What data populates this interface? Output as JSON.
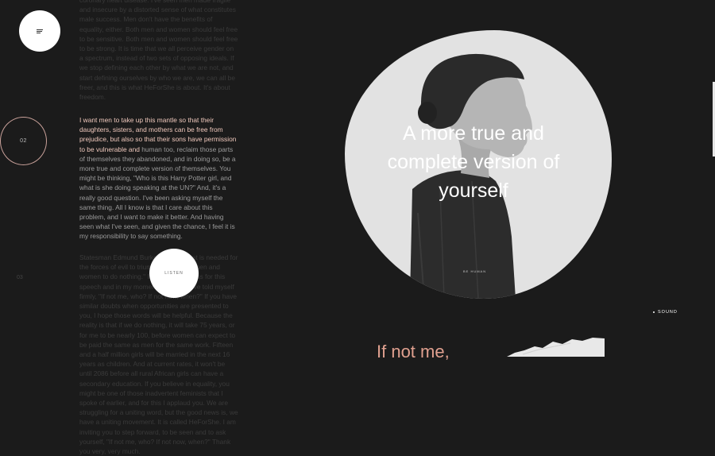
{
  "nav": {
    "menu_icon": "menu-icon"
  },
  "sections": [
    {
      "number": "02"
    },
    {
      "number": "03"
    }
  ],
  "article": {
    "para_top": "coronary heart disease. I've seen men made fragile and insecure by a distorted sense of what constitutes male success. Men don't have the benefits of equality, either. Both men and women should feel free to be sensitive. Both men and women should feel free to be strong. It is time that we all perceive gender on a spectrum, instead of two sets of opposing ideals. If we stop defining each other by what we are not, and start defining ourselves by who we are, we can all be freer, and this is what HeForShe is about. It's about freedom.",
    "para_mid_highlight": "I want men to take up this mantle so that their daughters, sisters, and mothers can be free from prejudice, but also so that their sons have permission to be vulnerable and",
    "para_mid_rest": " human too, reclaim those parts of themselves they abandoned, and in doing so, be a more true and complete version of themselves. You might be thinking, \"Who is this Harry Potter girl, and what is she doing speaking at the UN?\" And, it's a really good question. I've been asking myself the same thing. All I know is that I care about this problem, and I want to make it better. And having seen what I've seen, and given the chance, I feel it is my responsibility to say something.",
    "para_bot": "Statesman Edmund Burke said, \"All that is needed for the forces of evil to triumph is for good men and women to do nothing.\" In my nervousness for this speech and in my moments of doubt, I've told myself firmly, \"If not me, who? If not now, when?\" If you have similar doubts when opportunities are presented to you, I hope those words will be helpful. Because the reality is that if we do nothing, it will take 75 years, or for me to be nearly 100, before women can expect to be paid the same as men for the same work. Fifteen and a half million girls will be married in the next 16 years as children. And at current rates, it won't be until 2086 before all rural African girls can have a secondary education. If you believe in equality, you might be one of those inadvertent feminists that I spoke of earlier, and for this I applaud you. We are struggling for a uniting word, but the good news is, we have a uniting movement. It is called HeForShe. I am inviting you to step forward, to be seen and to ask yourself, \"If not me, who? If not now, when?\" Thank you very, very much."
  },
  "listen_button": "LISTEN",
  "hero": {
    "headline": "A more true and complete version of yourself",
    "shirt_text": "BE HUMAN"
  },
  "sound_toggle": "SOUND",
  "next_heading": "If not me,",
  "colors": {
    "background": "#1b1b1b",
    "accent": "#e0a08f",
    "highlight": "#f0c9bd",
    "blob": "#e2e2e2"
  }
}
